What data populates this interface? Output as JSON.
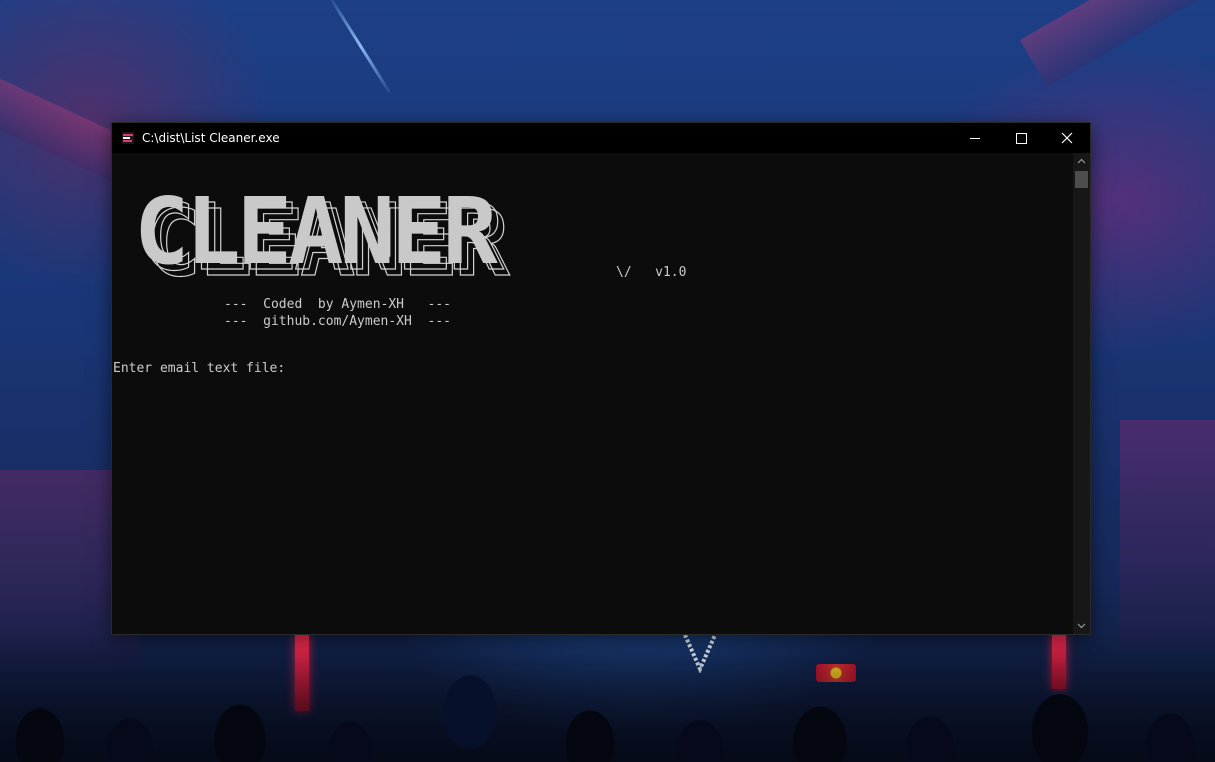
{
  "window": {
    "title": "C:\\dist\\List Cleaner.exe"
  },
  "console": {
    "banner_text": "CLEANER",
    "version_line": "\\/   v1.0",
    "coded_line": "---  Coded  by Aymen-XH   ---",
    "github_line": "---  github.com/Aymen-XH  ---",
    "prompt": "Enter email text file:"
  },
  "icons": {
    "app": "list-cleaner-app-icon",
    "minimize": "minimize-icon",
    "maximize": "maximize-icon",
    "close": "close-icon",
    "scroll_up": "chevron-up-icon",
    "scroll_down": "chevron-down-icon"
  },
  "colors": {
    "console_bg": "#0c0c0c",
    "console_text": "#cccccc",
    "titlebar_bg": "#000000",
    "banner_fill": "#c9c9c9"
  }
}
